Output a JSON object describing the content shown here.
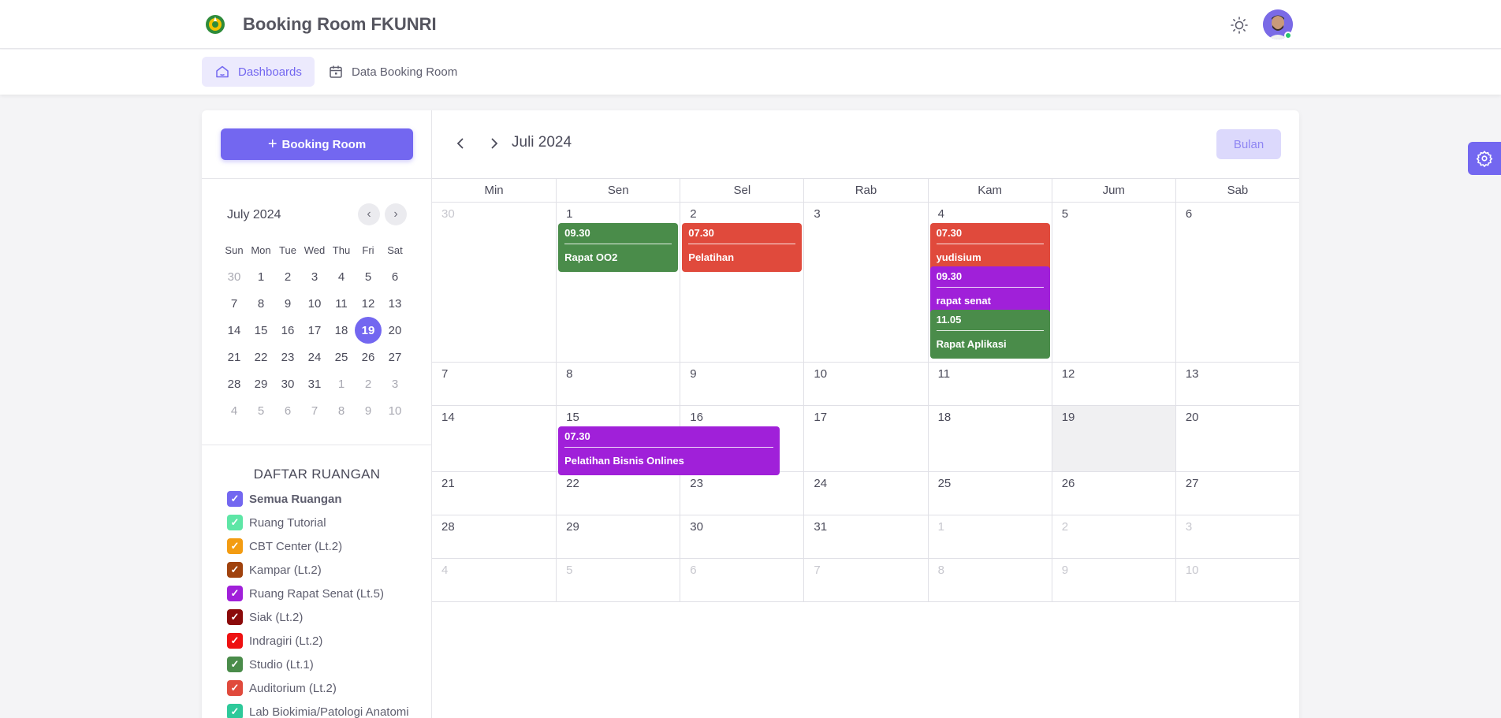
{
  "app": {
    "title": "Booking Room FKUNRI"
  },
  "nav": [
    {
      "label": "Dashboards",
      "icon": "home-icon",
      "active": true
    },
    {
      "label": "Data Booking Room",
      "icon": "calendar-icon",
      "active": false
    }
  ],
  "sidebar": {
    "book_button": "Booking Room",
    "mini_calendar": {
      "title": "July 2024",
      "weekdays": [
        "Sun",
        "Mon",
        "Tue",
        "Wed",
        "Thu",
        "Fri",
        "Sat"
      ],
      "weeks": [
        [
          "30",
          "1",
          "2",
          "3",
          "4",
          "5",
          "6"
        ],
        [
          "7",
          "8",
          "9",
          "10",
          "11",
          "12",
          "13"
        ],
        [
          "14",
          "15",
          "16",
          "17",
          "18",
          "19",
          "20"
        ],
        [
          "21",
          "22",
          "23",
          "24",
          "25",
          "26",
          "27"
        ],
        [
          "28",
          "29",
          "30",
          "31",
          "1",
          "2",
          "3"
        ],
        [
          "4",
          "5",
          "6",
          "7",
          "8",
          "9",
          "10"
        ]
      ],
      "selected": "19"
    },
    "rooms_title": "DAFTAR RUANGAN",
    "rooms": [
      {
        "label": "Semua Ruangan",
        "color": "#7367f0",
        "bold": true
      },
      {
        "label": "Ruang Tutorial",
        "color": "#5ee6a6"
      },
      {
        "label": "CBT Center (Lt.2)",
        "color": "#f39c12"
      },
      {
        "label": "Kampar (Lt.2)",
        "color": "#a0420d"
      },
      {
        "label": "Ruang Rapat Senat (Lt.5)",
        "color": "#a020d9"
      },
      {
        "label": "Siak (Lt.2)",
        "color": "#8b0a0a"
      },
      {
        "label": "Indragiri (Lt.2)",
        "color": "#ee1111"
      },
      {
        "label": "Studio (Lt.1)",
        "color": "#4a8c4a"
      },
      {
        "label": "Auditorium (Lt.2)",
        "color": "#e04a3c"
      },
      {
        "label": "Lab Biokimia/Patologi Anatomi",
        "color": "#2ec99a"
      }
    ]
  },
  "calendar": {
    "title": "Juli 2024",
    "view_button": "Bulan",
    "weekdays": [
      "Min",
      "Sen",
      "Sel",
      "Rab",
      "Kam",
      "Jum",
      "Sab"
    ],
    "weeks": [
      [
        "30",
        "1",
        "2",
        "3",
        "4",
        "5",
        "6"
      ],
      [
        "7",
        "8",
        "9",
        "10",
        "11",
        "12",
        "13"
      ],
      [
        "14",
        "15",
        "16",
        "17",
        "18",
        "19",
        "20"
      ],
      [
        "21",
        "22",
        "23",
        "24",
        "25",
        "26",
        "27"
      ],
      [
        "28",
        "29",
        "30",
        "31",
        "1",
        "2",
        "3"
      ],
      [
        "4",
        "5",
        "6",
        "7",
        "8",
        "9",
        "10"
      ]
    ],
    "today": "19",
    "events": [
      {
        "time": "09.30",
        "name": "Rapat OO2",
        "color": "#4a8c4a"
      },
      {
        "time": "07.30",
        "name": "Pelatihan",
        "color": "#e04a3c"
      },
      {
        "time": "07.30",
        "name": "yudisium",
        "color": "#e04a3c"
      },
      {
        "time": "09.30",
        "name": "rapat senat",
        "color": "#a020d9"
      },
      {
        "time": "11.05",
        "name": "Rapat Aplikasi",
        "color": "#4a8c4a"
      },
      {
        "time": "07.30",
        "name": "Pelatihan Bisnis Onlines",
        "color": "#a020d9"
      }
    ]
  }
}
